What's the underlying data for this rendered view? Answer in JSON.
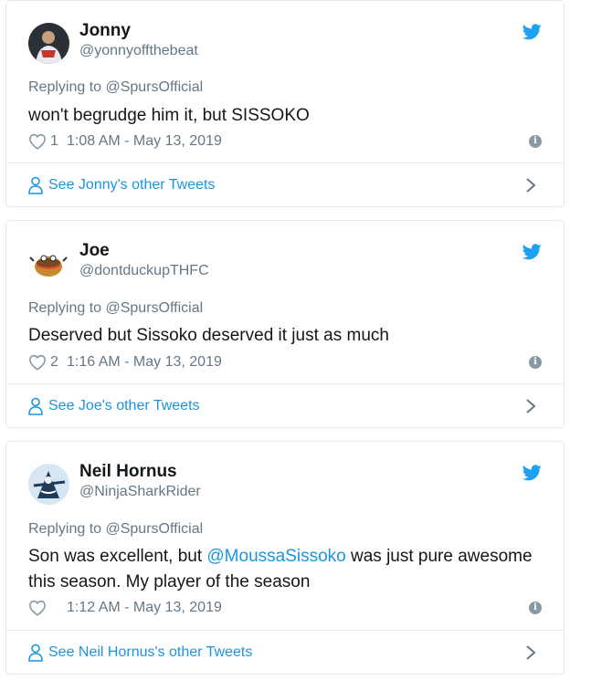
{
  "colors": {
    "accent": "#1b95e0",
    "muted": "#657786",
    "border": "#e1e8ed",
    "text": "#14171a"
  },
  "icons": {
    "twitter": "twitter-bird-icon",
    "like": "heart-icon",
    "info": "info-icon",
    "profile": "user-icon",
    "next": "chevron-right-icon"
  },
  "tweets": [
    {
      "name": "Jonny",
      "handle": "@yonnyoffthebeat",
      "replying_to": "Replying to @SpursOfficial",
      "text": "won't begrudge him it, but SISSOKO",
      "likes": "1",
      "timestamp": "1:08 AM - May 13, 2019",
      "see_more": "See Jonny's other Tweets"
    },
    {
      "name": "Joe",
      "handle": "@dontduckupTHFC",
      "replying_to": "Replying to @SpursOfficial",
      "text": "Deserved but Sissoko deserved it just as much",
      "likes": "2",
      "timestamp": "1:16 AM - May 13, 2019",
      "see_more": "See Joe's other Tweets"
    },
    {
      "name": "Neil Hornus",
      "handle": "@NinjaSharkRider",
      "replying_to": "Replying to @SpursOfficial",
      "text_before": "Son was excellent, but ",
      "text_mention": "@MoussaSissoko",
      "text_after": " was just pure awesome this season. My player of the season",
      "likes": "",
      "timestamp": "1:12 AM - May 13, 2019",
      "see_more": "See Neil Hornus's other Tweets"
    }
  ]
}
